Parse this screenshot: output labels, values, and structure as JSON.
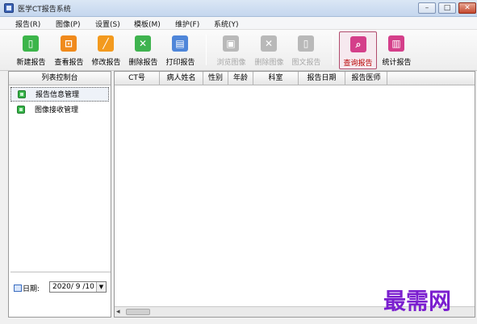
{
  "window": {
    "title": "医学CT报告系统",
    "controls": {
      "minimize": "–",
      "maximize": "□",
      "close": "✕"
    }
  },
  "menu": [
    {
      "label": "报告(R)"
    },
    {
      "label": "图像(P)"
    },
    {
      "label": "设置(S)"
    },
    {
      "label": "模板(M)"
    },
    {
      "label": "维护(F)"
    },
    {
      "label": "系统(Y)"
    }
  ],
  "toolbar": [
    {
      "label": "新建报告",
      "icon": "new-report-icon",
      "color": "#3cb54a",
      "glyph": "▯",
      "enabled": true
    },
    {
      "label": "查看报告",
      "icon": "view-report-icon",
      "color": "#f08a1c",
      "glyph": "⊡",
      "enabled": true
    },
    {
      "label": "修改报告",
      "icon": "edit-report-icon",
      "color": "#f39a1e",
      "glyph": "╱",
      "enabled": true
    },
    {
      "label": "删除报告",
      "icon": "delete-report-icon",
      "color": "#3fb34f",
      "glyph": "✕",
      "enabled": true
    },
    {
      "label": "打印报告",
      "icon": "print-report-icon",
      "color": "#4f86d9",
      "glyph": "▤",
      "enabled": true
    },
    {
      "label": "浏览图像",
      "icon": "browse-image-icon",
      "color": "#b9b9b9",
      "glyph": "▣",
      "enabled": false
    },
    {
      "label": "删除图像",
      "icon": "delete-image-icon",
      "color": "#b9b9b9",
      "glyph": "✕",
      "enabled": false
    },
    {
      "label": "图文报告",
      "icon": "image-report-icon",
      "color": "#b9b9b9",
      "glyph": "▯",
      "enabled": false
    },
    {
      "label": "查询报告",
      "icon": "search-report-icon",
      "color": "#d43f8a",
      "glyph": "⌕",
      "enabled": true,
      "active": true
    },
    {
      "label": "统计报告",
      "icon": "stats-report-icon",
      "color": "#d43f8a",
      "glyph": "▥",
      "enabled": true
    }
  ],
  "left_panel": {
    "header": "列表控制台",
    "items": [
      {
        "label": "报告信息管理",
        "selected": true
      },
      {
        "label": "图像接收管理",
        "selected": false
      }
    ],
    "date_label": "日期:",
    "date_value": "2020/ 9 /10",
    "date_dropdown": "▼"
  },
  "table": {
    "columns": [
      "CT号",
      "病人姓名",
      "性别",
      "年龄",
      "科室",
      "报告日期",
      "报告医师"
    ],
    "rows": []
  },
  "scrollbar": {
    "left_arrow": "◂"
  },
  "watermark": "最需网"
}
